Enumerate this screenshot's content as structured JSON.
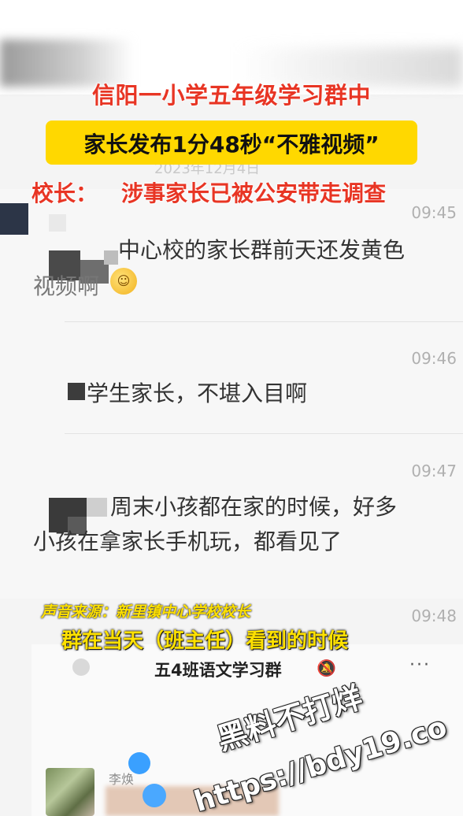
{
  "captions": {
    "title": "信阳一小学五年级学习群中",
    "subtitle": "家长发布1分48秒“不雅视频”",
    "headline_label": "校长：",
    "headline_text": "涉事家长已被公安带走调查",
    "source": "声音来源：新里镇中心学校校长",
    "quote": "群在当天（班主任）看到的时候"
  },
  "chat": {
    "date_faded": "2023年12月4日",
    "messages": [
      {
        "time": "09:45",
        "line1": "中心校的家长群前天还发黄色",
        "line2": "视频啊"
      },
      {
        "time": "09:46",
        "line1": "学生家长，不堪入目啊"
      },
      {
        "time": "09:47",
        "line1": "周末小孩都在家的时候，好多",
        "line2": "小孩在拿家长手机玩，都看见了"
      },
      {
        "time": "09:48"
      }
    ]
  },
  "phone": {
    "group_title": "五4班语文学习群",
    "more_label": "···",
    "sender_name": "李焕"
  },
  "watermark": {
    "line1": "黑料不打烊",
    "line2": "https://bdy19.co"
  },
  "colors": {
    "caption_red": "#e83524",
    "caption_yellow_box": "#ffd800",
    "lower_caption_yellow": "#ffe100"
  },
  "icons": {
    "emoji": "grinning-face-icon",
    "bell": "bell-muted-icon",
    "more": "more-dots-icon",
    "back": "back-icon"
  }
}
